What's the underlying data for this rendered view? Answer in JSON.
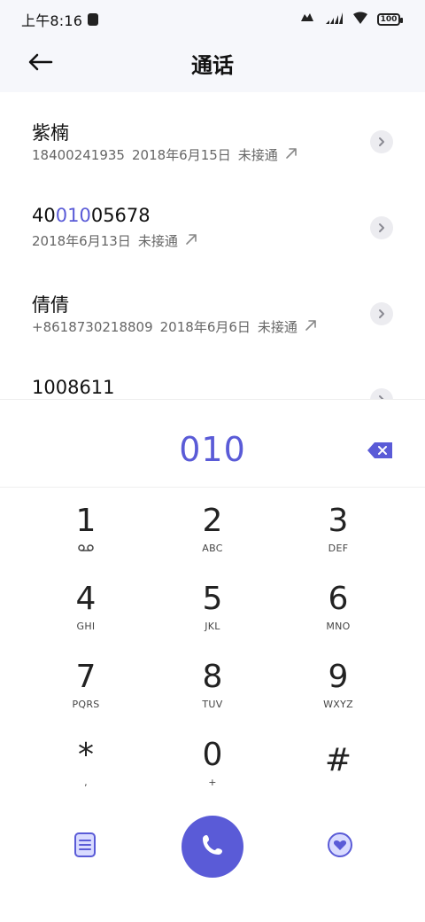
{
  "status_bar": {
    "time": "上午8:16",
    "battery": "100"
  },
  "header": {
    "title": "通话"
  },
  "calls": [
    {
      "title": "紫楠",
      "number": "18400241935",
      "date": "2018年6月15日",
      "status": "未接通"
    },
    {
      "title_parts": [
        "40",
        "010",
        "05678"
      ],
      "date": "2018年6月13日",
      "status": "未接通"
    },
    {
      "title": "倩倩",
      "number": "+8618730218809",
      "date": "2018年6月6日",
      "status": "未接通"
    },
    {
      "title": "1008611"
    }
  ],
  "dial": {
    "value": "010"
  },
  "keypad": [
    {
      "digit": "1",
      "sub_icon": "voicemail-icon"
    },
    {
      "digit": "2",
      "sub": "ABC"
    },
    {
      "digit": "3",
      "sub": "DEF"
    },
    {
      "digit": "4",
      "sub": "GHI"
    },
    {
      "digit": "5",
      "sub": "JKL"
    },
    {
      "digit": "6",
      "sub": "MNO"
    },
    {
      "digit": "7",
      "sub": "PQRS"
    },
    {
      "digit": "8",
      "sub": "TUV"
    },
    {
      "digit": "9",
      "sub": "WXYZ"
    },
    {
      "digit": "*",
      "sub": ","
    },
    {
      "digit": "0",
      "sub": "+"
    },
    {
      "digit": "#",
      "sub": ""
    }
  ],
  "bottom": {
    "left_icon": "notes-icon",
    "center_icon": "phone-icon",
    "right_icon": "favorites-icon"
  },
  "colors": {
    "accent": "#5a5bd7",
    "text": "#111111",
    "subtext": "#666666",
    "header_bg": "#f6f7fb"
  }
}
